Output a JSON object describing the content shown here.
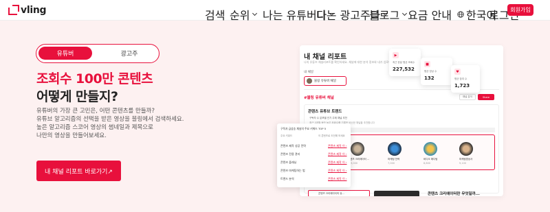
{
  "brand": {
    "name": "vling",
    "accent": "#e8103c"
  },
  "nav": {
    "search": "검색",
    "ranking": "순위",
    "youtuber": "나는 유튜버다",
    "advertiser": "나는 광고주다",
    "blog": "블로그",
    "pricing": "요금 안내",
    "language": "한국어",
    "login": "로그인",
    "signup": "회원가입"
  },
  "toggle": {
    "active": "유튜버",
    "inactive": "광고주"
  },
  "hero": {
    "headline_line1": "조회수 100만 콘텐츠",
    "headline_line2": "어떻게 만들지?",
    "description": [
      "유튜버의 가장 큰 고민은, 어떤 콘텐츠를 만들까?",
      "유튜브 알고리즘의 선택을 받은 영상을 블링에서 검색하세요.",
      "높은 알고리즘 스코어 영상의 썸네일과 제목으로",
      "나만의 영상을 만들어보세요."
    ],
    "cta": "내 채널 리포트 바로가기↗"
  },
  "preview": {
    "title": "내 채널 리포트",
    "subtitle": "나의 유튜브 채널리포트를 확인하세요. 채널에 대한 분석 정보와 내가 업로드한 영상 정보를 한 눈에 볼 수 있습니다.",
    "label": "내 채널",
    "select_value": "블링 유튜버 채널",
    "channel_tag": "#블링 유튜버 채널",
    "btn_secondary": "채널 분석",
    "btn_primary": "Share",
    "section_title": "콘텐츠 유튜브 트렌드",
    "section_sub1": "구독자 수 분포별 인기 주제 채널 추천",
    "section_sub2": "최근 3개월 동안 높은 조회수를 기록한 비슷한 채널을 추천합니다",
    "thumbs": [
      {
        "label": "콘텐츠 크리에이터 ...",
        "num": "3,000"
      },
      {
        "label": "마케팅 전략",
        "num": "7,000"
      },
      {
        "label": "비디오 에디팅",
        "num": "8,800"
      },
      {
        "label": "마케팅영상사",
        "num": "9,100"
      }
    ],
    "bottom_card": "콘텐츠 크리에이터의 유...",
    "bottom_title": "콘텐츠 크리에이터란 무엇일까..."
  },
  "popup": {
    "header": "구독자 급상승 채널의 주요 키워드 TOP 5",
    "col_left": "주요 키워드",
    "col_right": "이 콘텐츠로 도전해 보세요",
    "rows": [
      {
        "left": "콘텐츠 제작 성공 전략",
        "right": "콘텐츠 제작 이 ›"
      },
      {
        "left": "콘텐츠 전용 관리",
        "right": "콘텐츠 제작 이 ›"
      },
      {
        "left": "콘텐츠 플래닝",
        "right": "콘텐츠 제작 이 ›"
      },
      {
        "left": "콘텐츠 마케팅하는 법",
        "right": "콘텐츠 제작 이 ›"
      },
      {
        "left": "트렌드 분석",
        "right": "콘텐츠 제작 이 ›"
      }
    ]
  },
  "stats": [
    {
      "label": "최근 한달 평균 조회수",
      "value": "227,532",
      "icon": "play-icon"
    },
    {
      "label": "평균 영상 수",
      "value": "132",
      "icon": "video-icon"
    },
    {
      "label": "평균 참여 수",
      "value": "1,723",
      "icon": "heart-icon"
    }
  ]
}
